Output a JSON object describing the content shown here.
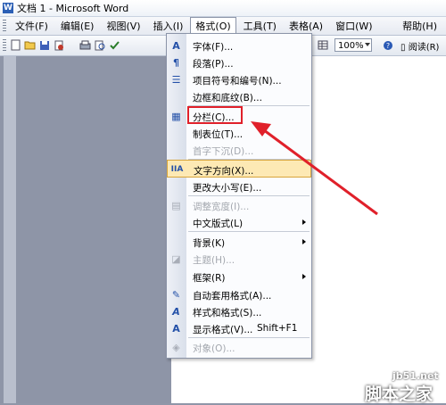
{
  "window": {
    "title": "文档 1 - Microsoft Word"
  },
  "menubar": {
    "items": [
      "文件(F)",
      "编辑(E)",
      "视图(V)",
      "插入(I)",
      "格式(O)",
      "工具(T)",
      "表格(A)",
      "窗口(W)",
      "帮助(H)"
    ],
    "active": "格式(O)"
  },
  "toolbar": {
    "zoom": "100%",
    "read_label": "阅读(R)",
    "icons": [
      "new-icon",
      "open-icon",
      "save-icon",
      "permission-icon",
      "print-icon",
      "preview-icon",
      "spell-icon",
      "table-icon",
      "help-icon",
      "read-icon"
    ]
  },
  "format_menu": {
    "items": [
      {
        "label": "字体(F)...",
        "icon": "A"
      },
      {
        "label": "段落(P)...",
        "icon": "¶"
      },
      {
        "label": "项目符号和编号(N)...",
        "icon": "☰"
      },
      {
        "label": "边框和底纹(B)...",
        "icon": ""
      },
      {
        "label": "分栏(C)...",
        "icon": "▦"
      },
      {
        "label": "制表位(T)...",
        "icon": ""
      },
      {
        "label": "首字下沉(D)...",
        "icon": ""
      },
      {
        "label": "文字方向(X)...",
        "icon": "IIA"
      },
      {
        "label": "更改大小写(E)...",
        "icon": ""
      },
      {
        "label": "调整宽度(I)...",
        "icon": "▤"
      },
      {
        "label": "中文版式(L)",
        "icon": ""
      },
      {
        "label": "背景(K)",
        "icon": ""
      },
      {
        "label": "主题(H)...",
        "icon": "◪"
      },
      {
        "label": "框架(R)",
        "icon": ""
      },
      {
        "label": "自动套用格式(A)...",
        "icon": "✎"
      },
      {
        "label": "样式和格式(S)...",
        "icon": "A"
      },
      {
        "label": "显示格式(V)...",
        "icon": "A"
      },
      {
        "label": "对象(O)...",
        "icon": "◈"
      }
    ],
    "shortcut": "Shift+F1",
    "highlighted": "文字方向(X)...",
    "annotated": "分栏(C)..."
  },
  "watermark": {
    "line1": "jb51.net",
    "line2": "脚本之家"
  },
  "colors": {
    "annotation_red": "#e0202a",
    "menu_highlight": "#fde9b4",
    "doc_background": "#8e95a7"
  }
}
